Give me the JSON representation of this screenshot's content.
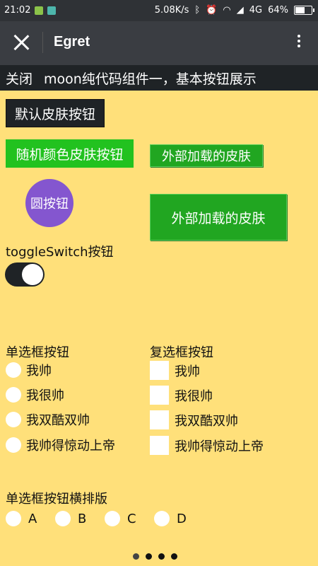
{
  "status_bar": {
    "time": "21:02",
    "speed": "5.08K/s",
    "network": "4G",
    "battery": "64%",
    "battery_level": 0.64
  },
  "title_bar": {
    "title": "Egret"
  },
  "header": {
    "close_label": "关闭",
    "description": "moon纯代码组件一，基本按钮展示"
  },
  "buttons": {
    "default_skin": "默认皮肤按钮",
    "random_color_skin": "随机颜色皮肤按钮",
    "external_skin_small": "外部加载的皮肤",
    "circle": "圆按钮",
    "external_skin_large": "外部加载的皮肤"
  },
  "toggle": {
    "label": "toggleSwitch按钮",
    "state": "on"
  },
  "radio_group": {
    "title": "单选框按钮",
    "items": [
      "我帅",
      "我很帅",
      "我双酷双帅",
      "我帅得惊动上帝"
    ]
  },
  "checkbox_group": {
    "title": "复选框按钮",
    "items": [
      "我帅",
      "我很帅",
      "我双酷双帅",
      "我帅得惊动上帝"
    ]
  },
  "horizontal_radio": {
    "title": "单选框按钮横排版",
    "items": [
      "A",
      "B",
      "C",
      "D"
    ]
  },
  "pager": {
    "count": 4,
    "active": 1
  },
  "colors": {
    "background": "#ffe07a",
    "dark": "#1f2326",
    "green": "#21a621",
    "bright_green": "#22c21f",
    "purple": "#8456cf"
  }
}
